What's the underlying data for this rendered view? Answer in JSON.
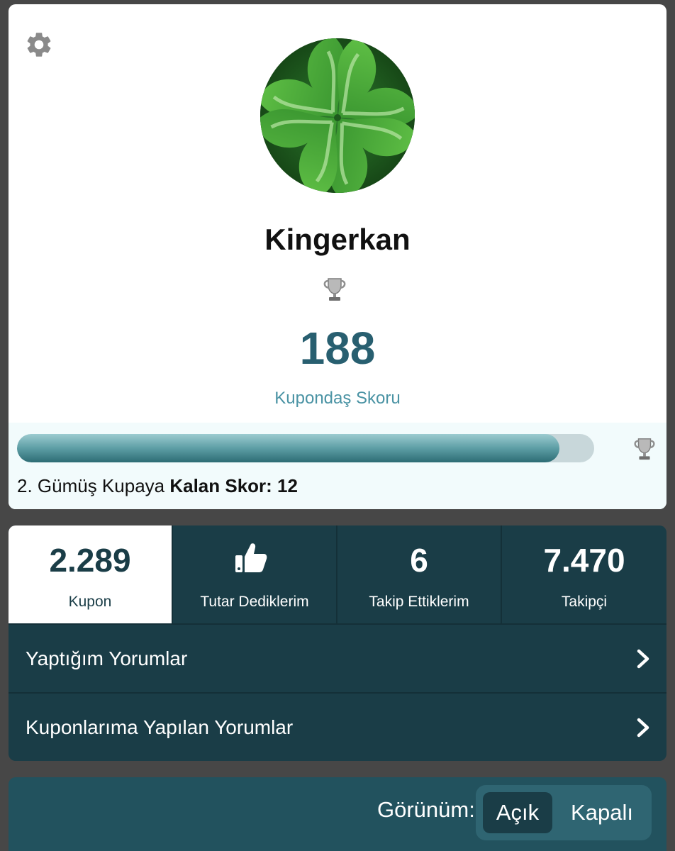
{
  "profile": {
    "username": "Kingerkan",
    "score": "188",
    "score_label": "Kupondaş Skoru"
  },
  "progress": {
    "fraction": 0.94,
    "text_prefix": "2. Gümüş Kupaya ",
    "text_bold": "Kalan Skor: 12"
  },
  "stats": [
    {
      "value": "2.289",
      "label": "Kupon"
    },
    {
      "icon": "thumbs-up-icon",
      "label": "Tutar Dediklerim"
    },
    {
      "value": "6",
      "label": "Takip Ettiklerim"
    },
    {
      "value": "7.470",
      "label": "Takipçi"
    }
  ],
  "menu": [
    {
      "label": "Yaptığım Yorumlar"
    },
    {
      "label": "Kuponlarıma Yapılan Yorumlar"
    }
  ],
  "view": {
    "label": "Görünüm:",
    "on": "Açık",
    "off": "Kapalı"
  },
  "colors": {
    "accent": "#285f70",
    "panel": "#1a3d47",
    "bottom_bar": "#22525e",
    "background": "#474747"
  }
}
